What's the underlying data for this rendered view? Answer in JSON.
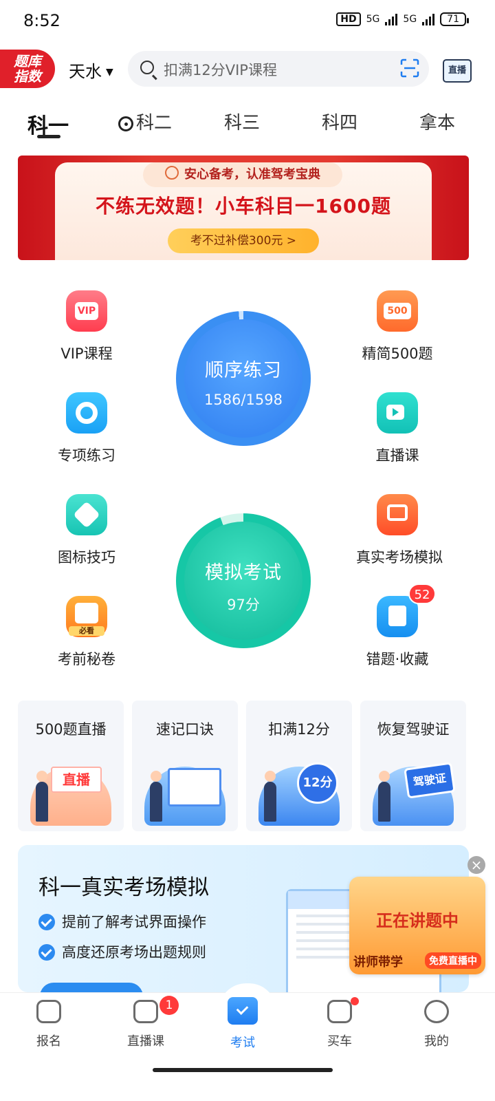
{
  "status_bar": {
    "time": "8:52",
    "hd": "HD",
    "net1": "5G",
    "net2": "5G",
    "battery": "71"
  },
  "header": {
    "logo_line1": "题库",
    "logo_line2": "指数",
    "city": "天水",
    "search_placeholder": "扣满12分VIP课程",
    "live_label": "直播"
  },
  "tabs": [
    {
      "label": "科一",
      "active": true
    },
    {
      "label": "科二"
    },
    {
      "label": "科三"
    },
    {
      "label": "科四"
    },
    {
      "label": "拿本"
    }
  ],
  "banner": {
    "tagline": "安心备考，认准驾考宝典",
    "headline": "不练无效题！小车科目一1600题",
    "cta": "考不过补偿300元 >"
  },
  "features": {
    "vip": {
      "label": "VIP课程",
      "icon_text": "VIP"
    },
    "special": {
      "label": "专项练习"
    },
    "sign_tips": {
      "label": "图标技巧"
    },
    "secret": {
      "label": "考前秘卷",
      "icon_text": "必看"
    },
    "simplified": {
      "label": "精简500题",
      "icon_text": "500"
    },
    "live_class": {
      "label": "直播课"
    },
    "real_exam": {
      "label": "真实考场模拟"
    },
    "mistakes": {
      "label": "错题·收藏",
      "badge": "52"
    }
  },
  "sequential": {
    "title": "顺序练习",
    "progress": "1586/1598"
  },
  "mock_exam": {
    "title": "模拟考试",
    "score": "97分"
  },
  "quick_cards": [
    {
      "title": "500题直播",
      "art_label": "直播"
    },
    {
      "title": "速记口诀"
    },
    {
      "title": "扣满12分",
      "art_label": "12分"
    },
    {
      "title": "恢复驾驶证",
      "art_label": "驾驶证"
    }
  ],
  "promo": {
    "title": "科一真实考场模拟",
    "point1": "提前了解考试界面操作",
    "point2": "高度还原考场出题规则"
  },
  "floating_ad": {
    "title": "正在讲题中",
    "left": "讲师带学",
    "right": "免费直播中",
    "close": "×"
  },
  "bottom_nav": [
    {
      "label": "报名"
    },
    {
      "label": "直播课",
      "badge": "1"
    },
    {
      "label": "考试",
      "active": true
    },
    {
      "label": "买车"
    },
    {
      "label": "我的"
    }
  ],
  "colors": {
    "accent": "#1f7df0",
    "brand_red": "#e0202a",
    "green": "#10b99a"
  }
}
